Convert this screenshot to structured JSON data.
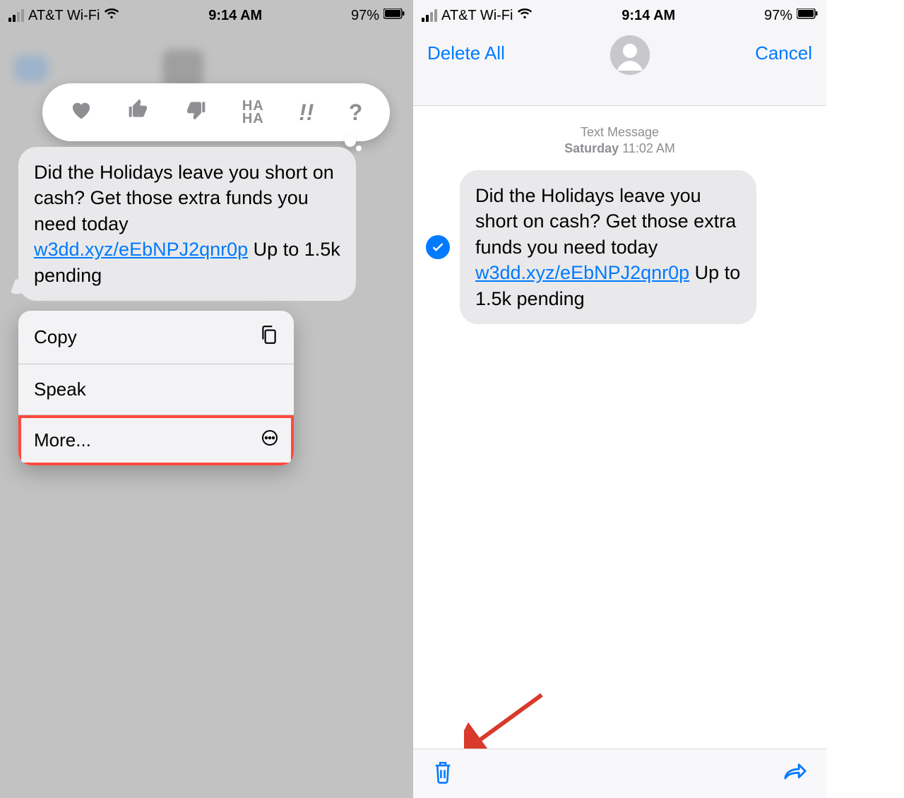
{
  "status_bar": {
    "carrier": "AT&T Wi-Fi",
    "time": "9:14 AM",
    "battery_pct": "97%"
  },
  "reactions": {
    "heart": "heart-icon",
    "thumbs_up": "thumbs-up-icon",
    "thumbs_down": "thumbs-down-icon",
    "haha_line1": "HA",
    "haha_line2": "HA",
    "exclaim": "!!",
    "question": "?"
  },
  "message": {
    "text_before_link": " Did the Holidays leave you short on cash? Get those extra funds you need today ",
    "link": "w3dd.xyz/eEbNPJ2qnr0p",
    "text_after_link": " Up to 1.5k pending"
  },
  "context_menu": {
    "copy": "Copy",
    "speak": "Speak",
    "more": "More..."
  },
  "edit_header": {
    "delete_all": "Delete All",
    "cancel": "Cancel"
  },
  "timestamp": {
    "label": "Text Message",
    "day": "Saturday",
    "time": "11:02 AM"
  }
}
